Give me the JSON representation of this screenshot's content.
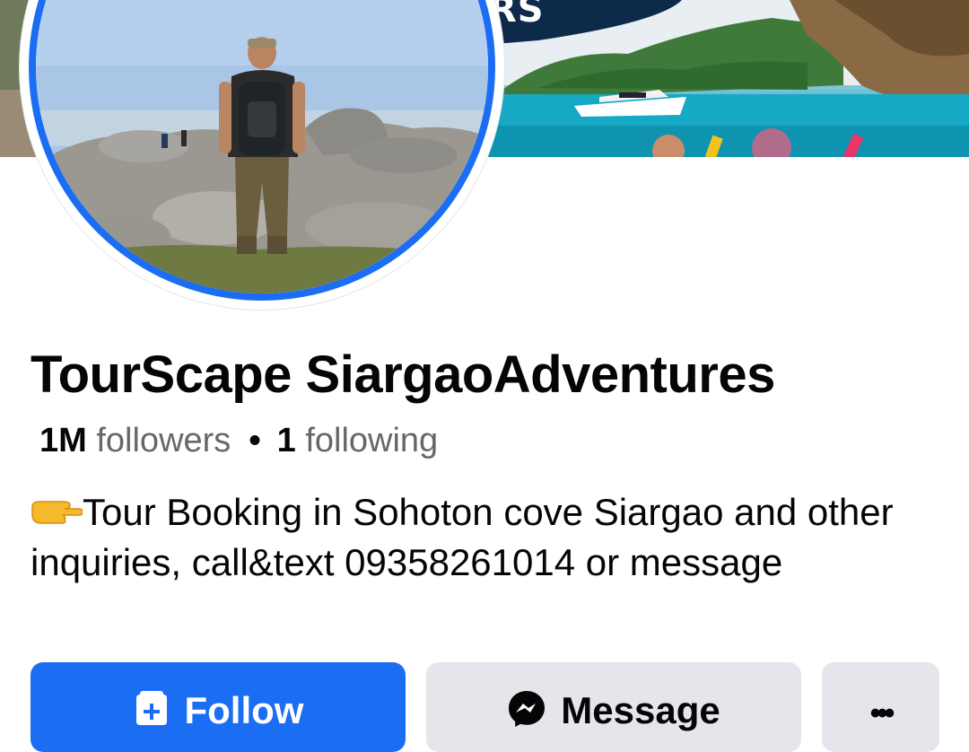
{
  "cover": {
    "partial_text": "RS"
  },
  "profile": {
    "name": "TourScape SiargaoAdventures",
    "followers_count": "1M",
    "followers_label": "followers",
    "separator": "•",
    "following_count": "1",
    "following_label": "following",
    "bio_emoji": "pointing-right-emoji",
    "bio": "Tour Booking in Sohoton cove Siargao and other inquiries, call&text 09358261014 or message"
  },
  "actions": {
    "follow_label": "Follow",
    "follow_icon": "add-friend-icon",
    "message_label": "Message",
    "message_icon": "messenger-icon",
    "more_label": "•••",
    "more_icon": "more-icon"
  },
  "colors": {
    "accent": "#1b6ef3",
    "secondary_button": "#e4e6eb",
    "text_primary": "#050505",
    "text_secondary": "#65676b"
  }
}
